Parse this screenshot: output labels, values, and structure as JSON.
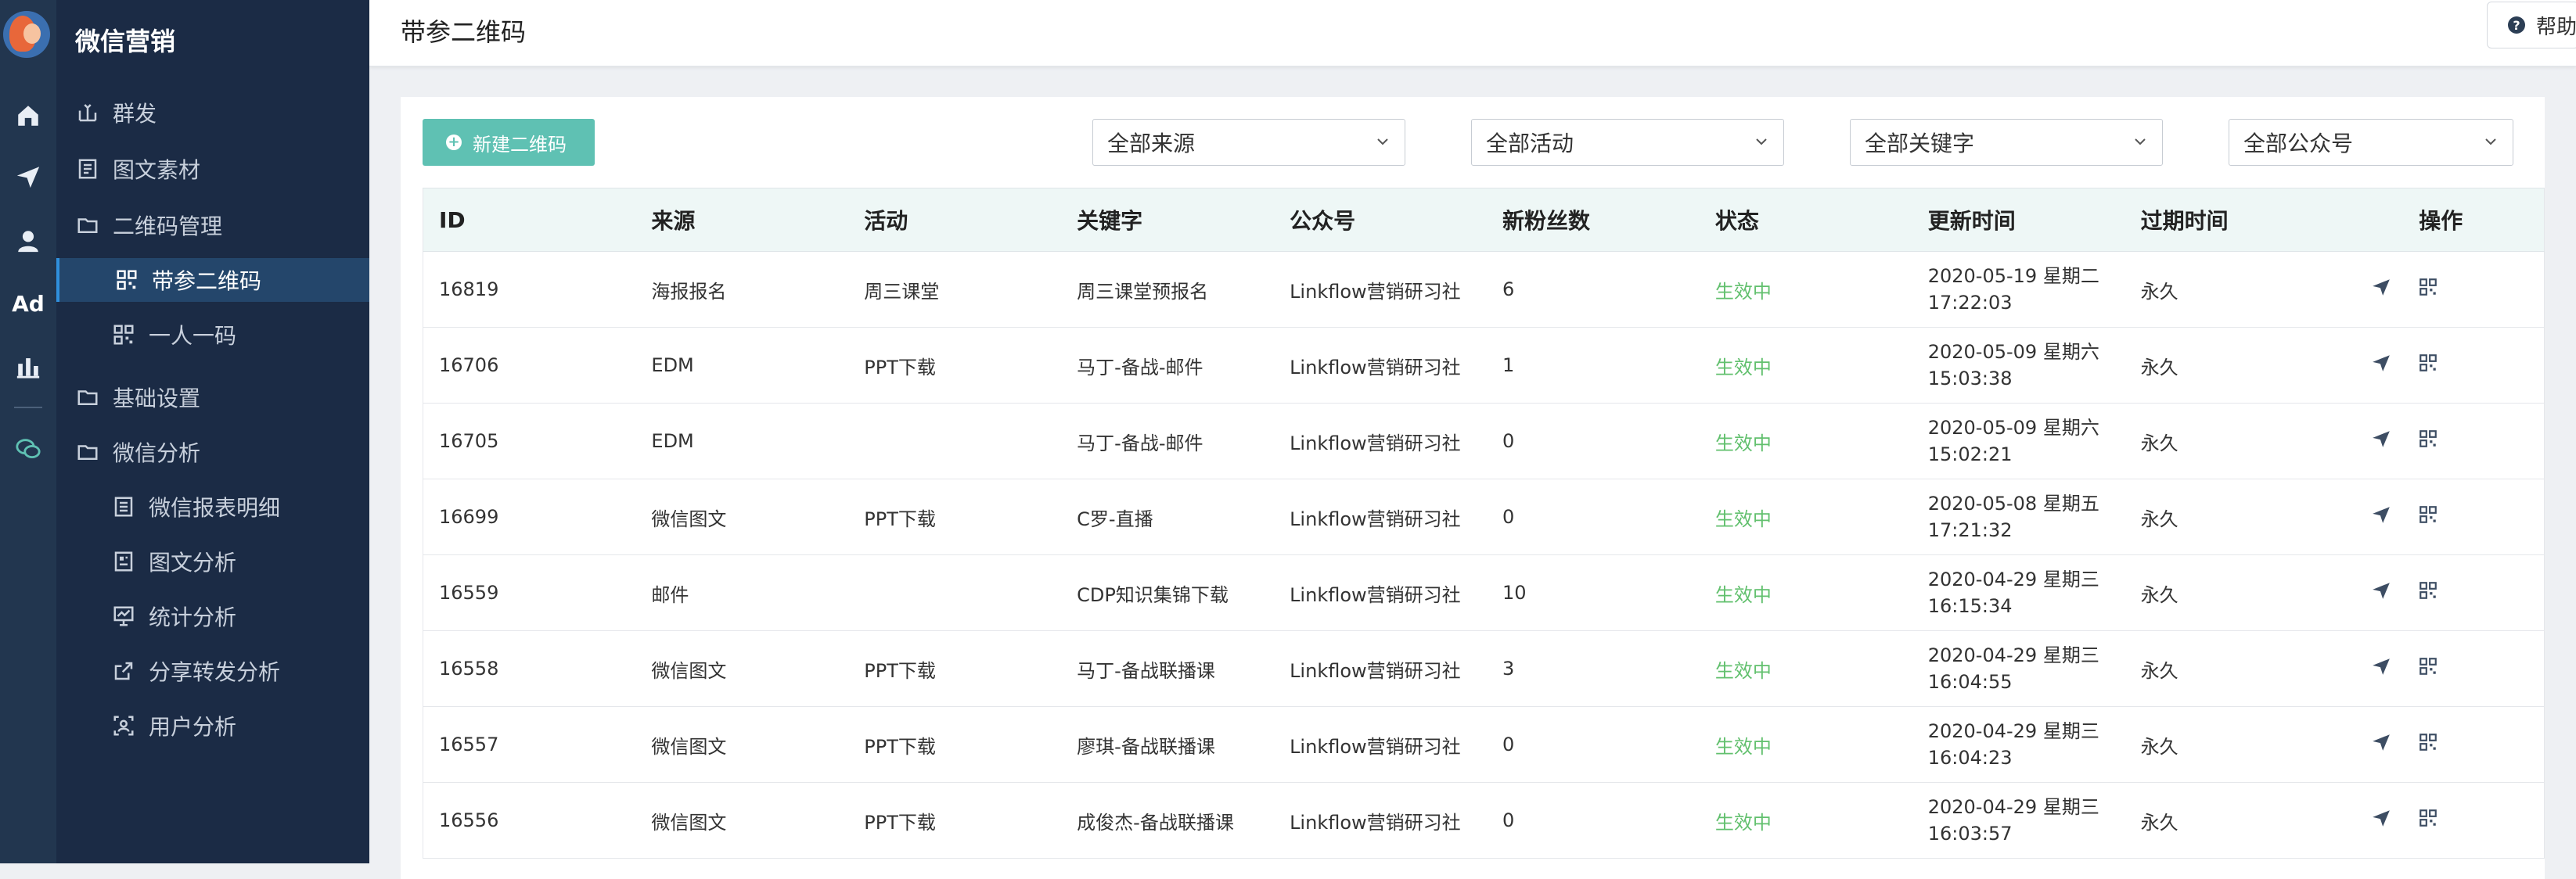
{
  "app": {
    "brand": "微信营销"
  },
  "colors": {
    "accent": "#5fc1b3",
    "status_active": "#62c06e",
    "nav_bg": "#1b2b45",
    "rail_bg": "#22364f"
  },
  "rail": {
    "icons": [
      "home-icon",
      "send-icon",
      "user-icon",
      "ad-icon",
      "bar-chart-icon",
      "wechat-icon"
    ],
    "ad_label": "Ad"
  },
  "nav": {
    "items": [
      {
        "label": "群发",
        "icon": "mass-send-icon",
        "level": 1
      },
      {
        "label": "图文素材",
        "icon": "document-icon",
        "level": 1
      },
      {
        "label": "二维码管理",
        "icon": "folder-icon",
        "level": 1
      },
      {
        "label": "带参二维码",
        "icon": "qrcode-icon",
        "level": 2,
        "active": true
      },
      {
        "label": "一人一码",
        "icon": "qrcode-icon",
        "level": 2
      },
      {
        "label": "基础设置",
        "icon": "folder-icon",
        "level": 1
      },
      {
        "label": "微信分析",
        "icon": "folder-icon",
        "level": 1
      },
      {
        "label": "微信报表明细",
        "icon": "report-icon",
        "level": 2
      },
      {
        "label": "图文分析",
        "icon": "article-analysis-icon",
        "level": 2
      },
      {
        "label": "统计分析",
        "icon": "statistics-icon",
        "level": 2
      },
      {
        "label": "分享转发分析",
        "icon": "share-icon",
        "level": 2
      },
      {
        "label": "用户分析",
        "icon": "user-analysis-icon",
        "level": 2
      }
    ]
  },
  "header": {
    "title": "带参二维码",
    "help_label": "帮助"
  },
  "toolbar": {
    "new_button": "新建二维码",
    "filters": [
      "全部来源",
      "全部活动",
      "全部关键字",
      "全部公众号"
    ]
  },
  "table": {
    "columns": [
      "ID",
      "来源",
      "活动",
      "关键字",
      "公众号",
      "新粉丝数",
      "状态",
      "更新时间",
      "过期时间",
      "操作"
    ],
    "rows": [
      {
        "id": "16819",
        "source": "海报报名",
        "activity": "周三课堂",
        "keyword": "周三课堂预报名",
        "account": "Linkflow营销研习社",
        "fans": "6",
        "status": "生效中",
        "updated_date": "2020-05-19 星期二",
        "updated_time": "17:22:03",
        "expire": "永久"
      },
      {
        "id": "16706",
        "source": "EDM",
        "activity": "PPT下载",
        "keyword": "马丁-备战-邮件",
        "account": "Linkflow营销研习社",
        "fans": "1",
        "status": "生效中",
        "updated_date": "2020-05-09 星期六",
        "updated_time": "15:03:38",
        "expire": "永久"
      },
      {
        "id": "16705",
        "source": "EDM",
        "activity": "",
        "keyword": "马丁-备战-邮件",
        "account": "Linkflow营销研习社",
        "fans": "0",
        "status": "生效中",
        "updated_date": "2020-05-09 星期六",
        "updated_time": "15:02:21",
        "expire": "永久"
      },
      {
        "id": "16699",
        "source": "微信图文",
        "activity": "PPT下载",
        "keyword": "C罗-直播",
        "account": "Linkflow营销研习社",
        "fans": "0",
        "status": "生效中",
        "updated_date": "2020-05-08 星期五",
        "updated_time": "17:21:32",
        "expire": "永久"
      },
      {
        "id": "16559",
        "source": "邮件",
        "activity": "",
        "keyword": "CDP知识集锦下载",
        "account": "Linkflow营销研习社",
        "fans": "10",
        "status": "生效中",
        "updated_date": "2020-04-29 星期三",
        "updated_time": "16:15:34",
        "expire": "永久"
      },
      {
        "id": "16558",
        "source": "微信图文",
        "activity": "PPT下载",
        "keyword": "马丁-备战联播课",
        "account": "Linkflow营销研习社",
        "fans": "3",
        "status": "生效中",
        "updated_date": "2020-04-29 星期三",
        "updated_time": "16:04:55",
        "expire": "永久"
      },
      {
        "id": "16557",
        "source": "微信图文",
        "activity": "PPT下载",
        "keyword": "廖琪-备战联播课",
        "account": "Linkflow营销研习社",
        "fans": "0",
        "status": "生效中",
        "updated_date": "2020-04-29 星期三",
        "updated_time": "16:04:23",
        "expire": "永久"
      },
      {
        "id": "16556",
        "source": "微信图文",
        "activity": "PPT下载",
        "keyword": "成俊杰-备战联播课",
        "account": "Linkflow营销研习社",
        "fans": "0",
        "status": "生效中",
        "updated_date": "2020-04-29 星期三",
        "updated_time": "16:03:57",
        "expire": "永久"
      }
    ]
  }
}
